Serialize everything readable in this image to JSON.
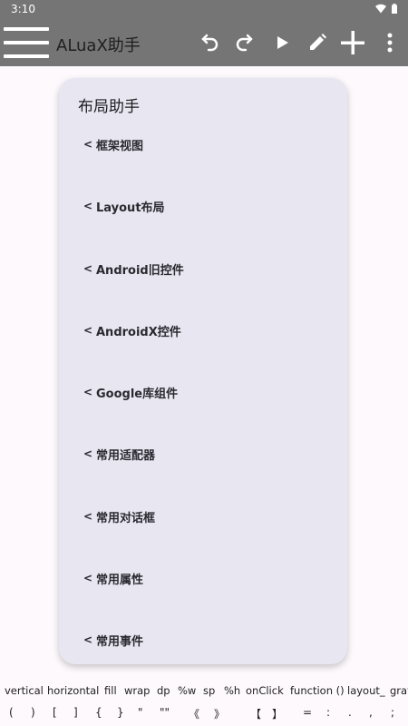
{
  "status": {
    "time": "3:10"
  },
  "appbar": {
    "title": "ALuaX助手"
  },
  "card": {
    "title": "布局助手",
    "chevron": "<",
    "items": [
      "框架视图",
      "Layout布局",
      "Android旧控件",
      "AndroidX控件",
      "Google库组件",
      "常用适配器",
      "常用对话框",
      "常用属性",
      "常用事件"
    ]
  },
  "keywords": [
    "vertical",
    "horizontal",
    "fill",
    "wrap",
    "dp",
    "%w",
    "sp",
    "%h",
    "onClick",
    "function ()",
    "layout_",
    "grav"
  ],
  "symbols": [
    "(",
    ")",
    "[",
    "]",
    "{",
    "}",
    "\"",
    "\"\"",
    "《",
    "》",
    "【",
    "】",
    "=",
    ":",
    ".",
    ",",
    ";"
  ],
  "colors": {
    "appbar": "#757575",
    "card": "#e8e6f0",
    "background": "#fdf9fd"
  }
}
